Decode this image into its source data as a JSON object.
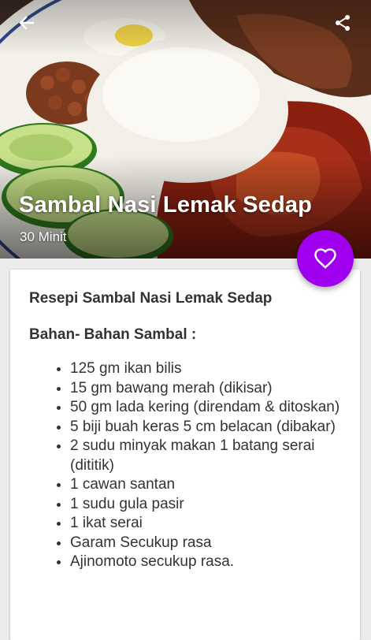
{
  "recipe": {
    "title": "Sambal Nasi Lemak Sedap",
    "time": "30 Minit"
  },
  "toolbar": {
    "back_icon": "arrow-left-icon",
    "share_icon": "share-icon"
  },
  "fab": {
    "icon": "heart-outline-icon",
    "color": "#a100f0"
  },
  "content": {
    "heading": "Resepi Sambal Nasi Lemak Sedap",
    "subheading": "Bahan- Bahan Sambal :",
    "ingredients": [
      "125 gm ikan bilis",
      "15 gm bawang merah (dikisar)",
      "50 gm lada kering (direndam & ditoskan)",
      "5 biji buah keras 5 cm belacan (dibakar)",
      "2 sudu minyak makan 1 batang serai (dititik)",
      "1 cawan santan",
      "1 sudu gula pasir",
      "1 ikat serai",
      "Garam Secukup rasa",
      "Ajinomoto secukup rasa."
    ]
  }
}
